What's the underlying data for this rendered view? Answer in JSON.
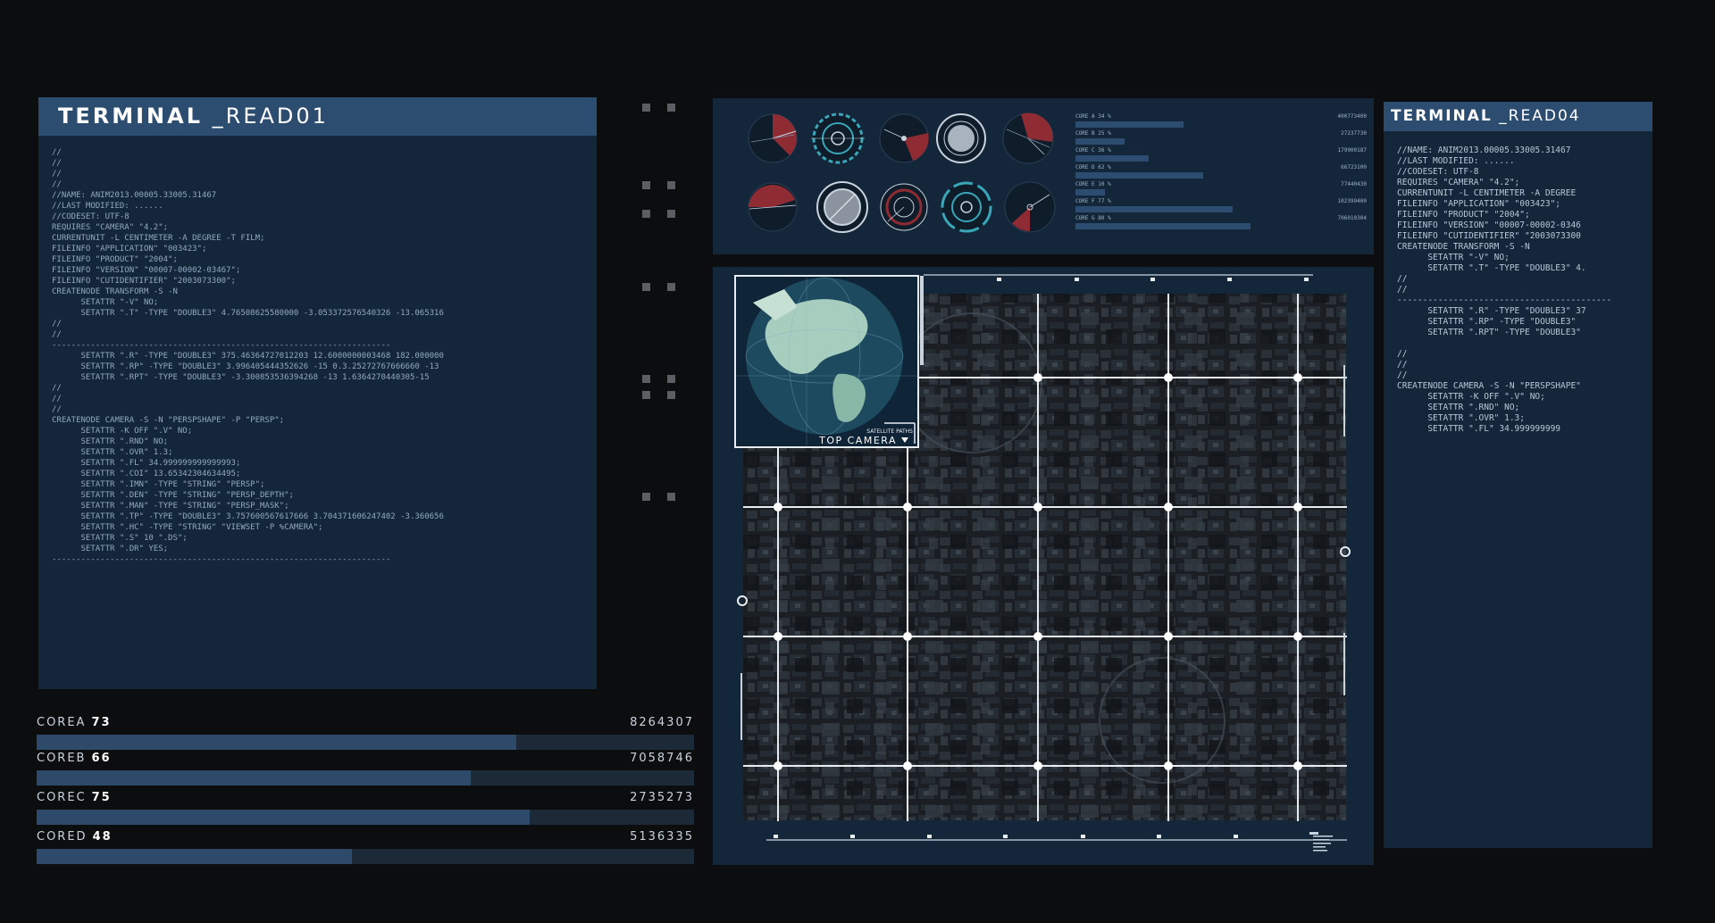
{
  "colors": {
    "background": "#0c0d0f",
    "panel": "#13263a",
    "header": "#2c4c70",
    "accent_red": "#b3353c",
    "accent_teal": "#3aa6b9"
  },
  "terminal1": {
    "title_bold": "TERMINAL",
    "title_thin": "_READ01",
    "code": "//\n//\n//\n//\n//NAME: ANIM2013.00005.33005.31467\n//LAST MODIFIED: ......\n//CODESET: UTF-8\nREQUIRES \"CAMERA\" \"4.2\";\nCURRENTUNIT -L CENTIMETER -A DEGREE -T FILM;\nFILEINFO \"APPLICATION\" \"003423\";\nFILEINFO \"PRODUCT\" \"2004\";\nFILEINFO \"VERSION\" \"00007-00002-03467\";\nFILEINFO \"CUTIDENTIFIER\" \"2003073300\";\nCREATENODE TRANSFORM -S -N\n      SETATTR \"-V\" NO;\n      SETATTR \".T\" -TYPE \"DOUBLE3\" 4.76508625580000 -3.053372576540326 -13.065316\n//\n//\n----------------------------------------------------------------------\n      SETATTR \".R\" -TYPE \"DOUBLE3\" 375.46364727012203 12.6000000003468 182.000000\n      SETATTR \".RP\" -TYPE \"DOUBLE3\" 3.996405444352626 -15 0.3.25272767666660 -13\n      SETATTR \".RPT\" -TYPE \"DOUBLE3\" -3.300853536394268 -13 1.6364270440305-15\n//\n//\n//\nCREATENODE CAMERA -S -N \"PERSPSHAPE\" -P \"PERSP\";\n      SETATTR -K OFF \".V\" NO;\n      SETATTR \".RND\" NO;\n      SETATTR \".OVR\" 1.3;\n      SETATTR \".FL\" 34.999999999999993;\n      SETATTR \".COI\" 13.65342304634495;\n      SETATTR \".IMN\" -TYPE \"STRING\" \"PERSP\";\n      SETATTR \".DEN\" -TYPE \"STRING\" \"PERSP_DEPTH\";\n      SETATTR \".MAN\" -TYPE \"STRING\" \"PERSP_MASK\";\n      SETATTR \".TP\" -TYPE \"DOUBLE3\" 3.757600567617666 3.704371606247402 -3.360656\n      SETATTR \".HC\" -TYPE \"STRING\" \"VIEWSET -P %CAMERA\";\n      SETATTR \".S\" 10 \".DS\";\n      SETATTR \".DR\" YES;\n----------------------------------------------------------------------"
  },
  "terminal4": {
    "title_bold": "TERMINAL",
    "title_thin": "_READ04",
    "code": "//NAME: ANIM2013.00005.33005.31467\n//LAST MODIFIED: ......\n//CODESET: UTF-8\nREQUIRES \"CAMERA\" \"4.2\";\nCURRENTUNIT -L CENTIMETER -A DEGREE\nFILEINFO \"APPLICATION\" \"003423\";\nFILEINFO \"PRODUCT\" \"2004\";\nFILEINFO \"VERSION\" \"00007-00002-0346\nFILEINFO \"CUTIDENTIFIER\" \"2003073300\nCREATENODE TRANSFORM -S -N\n      SETATTR \"-V\" NO;\n      SETATTR \".T\" -TYPE \"DOUBLE3\" 4.\n//\n//\n------------------------------------------\n      SETATTR \".R\" -TYPE \"DOUBLE3\" 37\n      SETATTR \".RP\" -TYPE \"DOUBLE3\"\n      SETATTR \".RPT\" -TYPE \"DOUBLE3\"\n\n//\n//\n//\nCREATENODE CAMERA -S -N \"PERSPSHAPE\"\n      SETATTR -K OFF \".V\" NO;\n      SETATTR \".RND\" NO;\n      SETATTR \".OVR\" 1.3;\n      SETATTR \".FL\" 34.999999999"
  },
  "cores": [
    {
      "name": "COREA",
      "percent": "73",
      "value": "8264307",
      "fill": 0.73
    },
    {
      "name": "COREB",
      "percent": "66",
      "value": "7058746",
      "fill": 0.66
    },
    {
      "name": "COREC",
      "percent": "75",
      "value": "2735273",
      "fill": 0.75
    },
    {
      "name": "CORED",
      "percent": "48",
      "value": "5136335",
      "fill": 0.48
    }
  ],
  "stats": [
    {
      "label": "CORE A 34 %",
      "value": "400773400",
      "fill": 0.37
    },
    {
      "label": "CORE B 25 %",
      "value": "27237730",
      "fill": 0.17
    },
    {
      "label": "CORE C 36 %",
      "value": "179900187",
      "fill": 0.25
    },
    {
      "label": "CORE D 62 %",
      "value": "66723100",
      "fill": 0.44
    },
    {
      "label": "CORE E 10 %",
      "value": "77440430",
      "fill": 0.1
    },
    {
      "label": "CORE F 77 %",
      "value": "102399400",
      "fill": 0.54
    },
    {
      "label": "CORE G 80 %",
      "value": "706010304",
      "fill": 0.6
    }
  ],
  "map": {
    "inset_caption_small": "SATELLITE PATHS",
    "inset_caption": "TOP CAMERA"
  }
}
